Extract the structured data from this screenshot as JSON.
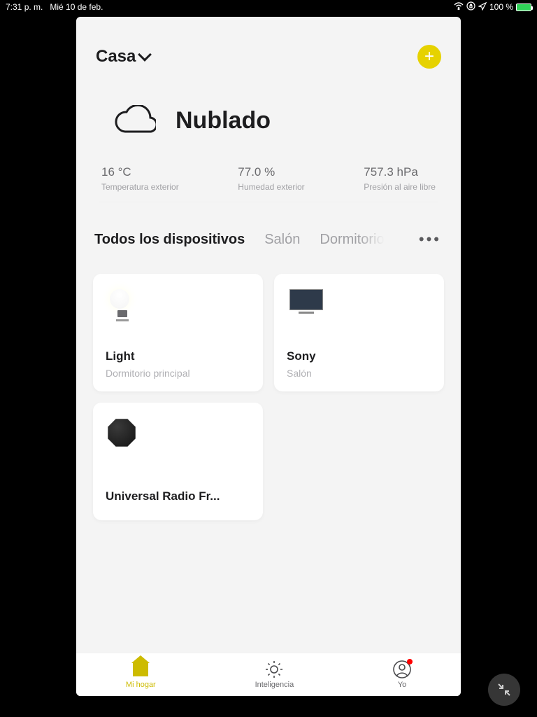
{
  "status": {
    "time": "7:31 p. m.",
    "date": "Mié 10 de feb.",
    "battery": "100 %"
  },
  "header": {
    "home_name": "Casa"
  },
  "weather": {
    "condition": "Nublado",
    "stats": [
      {
        "value": "16 °C",
        "label": "Temperatura exterior"
      },
      {
        "value": "77.0 %",
        "label": "Humedad exterior"
      },
      {
        "value": "757.3 hPa",
        "label": "Presión al aire libre"
      }
    ]
  },
  "tabs": {
    "items": [
      "Todos los dispositivos",
      "Salón",
      "Dormitorio"
    ],
    "active_index": 0
  },
  "devices": [
    {
      "name": "Light",
      "room": "Dormitorio principal",
      "icon": "light"
    },
    {
      "name": "Sony",
      "room": "Salón",
      "icon": "tv"
    },
    {
      "name": "Universal Radio Fr...",
      "room": "",
      "icon": "hub"
    }
  ],
  "nav": {
    "items": [
      "Mi hogar",
      "Inteligencia",
      "Yo"
    ],
    "active_index": 0
  },
  "accent_color": "#e6d200"
}
